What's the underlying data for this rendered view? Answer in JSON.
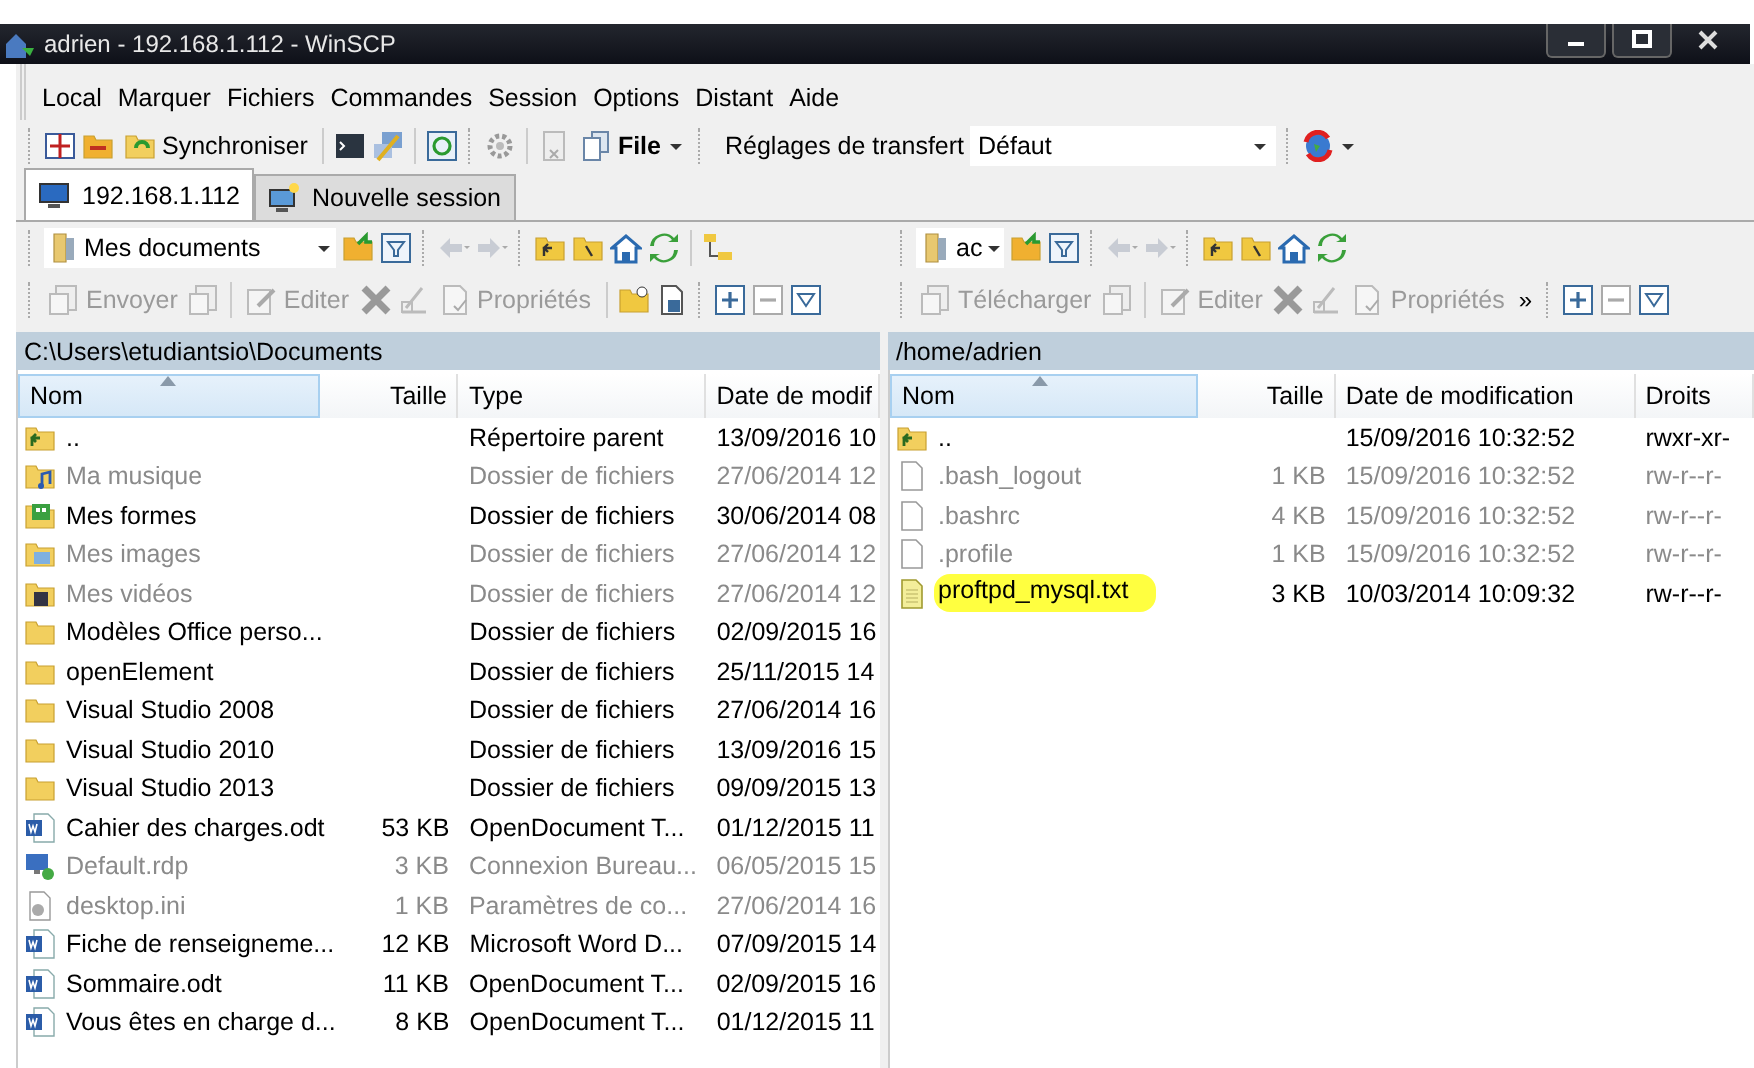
{
  "window": {
    "title": "adrien - 192.168.1.112 - WinSCP"
  },
  "menu": [
    "Local",
    "Marquer",
    "Fichiers",
    "Commandes",
    "Session",
    "Options",
    "Distant",
    "Aide"
  ],
  "toolbar": {
    "synchronize": "Synchroniser",
    "file": "File",
    "transfer_label": "Réglages de transfert",
    "transfer_value": "Défaut"
  },
  "tabs": [
    {
      "label": "192.168.1.112",
      "selected": true
    },
    {
      "label": "Nouvelle session",
      "selected": false
    }
  ],
  "left_panel": {
    "location": "Mes documents",
    "actions": [
      {
        "label": "Envoyer",
        "disabled": true
      },
      {
        "label": "Editer",
        "disabled": true
      },
      {
        "label": "Propriétés",
        "disabled": true
      }
    ],
    "path": "C:\\Users\\etudiantsio\\Documents",
    "columns": [
      "Nom",
      "Taille",
      "Type",
      "Date de modif"
    ],
    "rows": [
      {
        "kind": "parent",
        "dimmed": false,
        "name": "..",
        "type": "Répertoire parent",
        "date": "13/09/2016 10"
      },
      {
        "kind": "music",
        "dimmed": true,
        "name": "Ma musique",
        "type": "Dossier de fichiers",
        "date": "27/06/2014 12"
      },
      {
        "kind": "forms",
        "dimmed": false,
        "name": "Mes formes",
        "type": "Dossier de fichiers",
        "date": "30/06/2014 08"
      },
      {
        "kind": "images",
        "dimmed": true,
        "name": "Mes images",
        "type": "Dossier de fichiers",
        "date": "27/06/2014 12"
      },
      {
        "kind": "videos",
        "dimmed": true,
        "name": "Mes vidéos",
        "type": "Dossier de fichiers",
        "date": "27/06/2014 12"
      },
      {
        "kind": "folder",
        "dimmed": false,
        "name": "Modèles Office perso...",
        "type": "Dossier de fichiers",
        "date": "02/09/2015 16"
      },
      {
        "kind": "folder",
        "dimmed": false,
        "name": "openElement",
        "type": "Dossier de fichiers",
        "date": "25/11/2015 14"
      },
      {
        "kind": "folder",
        "dimmed": false,
        "name": "Visual Studio 2008",
        "type": "Dossier de fichiers",
        "date": "27/06/2014 16"
      },
      {
        "kind": "folder",
        "dimmed": false,
        "name": "Visual Studio 2010",
        "type": "Dossier de fichiers",
        "date": "13/09/2016 15"
      },
      {
        "kind": "folder",
        "dimmed": false,
        "name": "Visual Studio 2013",
        "type": "Dossier de fichiers",
        "date": "09/09/2015 13"
      },
      {
        "kind": "word",
        "dimmed": false,
        "name": "Cahier des charges.odt",
        "size": "53 KB",
        "type": "OpenDocument T...",
        "date": "01/12/2015 11"
      },
      {
        "kind": "rdp",
        "dimmed": true,
        "name": "Default.rdp",
        "size": "3 KB",
        "type": "Connexion Bureau...",
        "date": "06/05/2015 15"
      },
      {
        "kind": "ini",
        "dimmed": true,
        "name": "desktop.ini",
        "size": "1 KB",
        "type": "Paramètres de co...",
        "date": "27/06/2014 16"
      },
      {
        "kind": "word",
        "dimmed": false,
        "name": "Fiche de renseigneme...",
        "size": "12 KB",
        "type": "Microsoft Word D...",
        "date": "07/09/2015 14"
      },
      {
        "kind": "word",
        "dimmed": false,
        "name": "Sommaire.odt",
        "size": "11 KB",
        "type": "OpenDocument T...",
        "date": "02/09/2015 16"
      },
      {
        "kind": "word",
        "dimmed": false,
        "name": "Vous êtes en charge d...",
        "size": "8 KB",
        "type": "OpenDocument T...",
        "date": "01/12/2015 11"
      }
    ]
  },
  "right_panel": {
    "location": "ac",
    "actions": [
      {
        "label": "Télécharger",
        "disabled": true
      },
      {
        "label": "Editer",
        "disabled": true
      },
      {
        "label": "Propriétés",
        "disabled": true
      }
    ],
    "overflow": "»",
    "path": "/home/adrien",
    "columns": [
      "Nom",
      "Taille",
      "Date de modification",
      "Droits"
    ],
    "rows": [
      {
        "kind": "parent",
        "dimmed": false,
        "highlighted": false,
        "name": "..",
        "date": "15/09/2016 10:32:52",
        "rights": "rwxr-xr-"
      },
      {
        "kind": "file",
        "dimmed": true,
        "highlighted": false,
        "name": ".bash_logout",
        "size": "1 KB",
        "date": "15/09/2016 10:32:52",
        "rights": "rw-r--r-"
      },
      {
        "kind": "file",
        "dimmed": true,
        "highlighted": false,
        "name": ".bashrc",
        "size": "4 KB",
        "date": "15/09/2016 10:32:52",
        "rights": "rw-r--r-"
      },
      {
        "kind": "file",
        "dimmed": true,
        "highlighted": false,
        "name": ".profile",
        "size": "1 KB",
        "date": "15/09/2016 10:32:52",
        "rights": "rw-r--r-"
      },
      {
        "kind": "text",
        "dimmed": false,
        "highlighted": true,
        "name": "proftpd_mysql.txt",
        "size": "3 KB",
        "date": "10/03/2014 10:09:32",
        "rights": "rw-r--r-"
      }
    ]
  }
}
